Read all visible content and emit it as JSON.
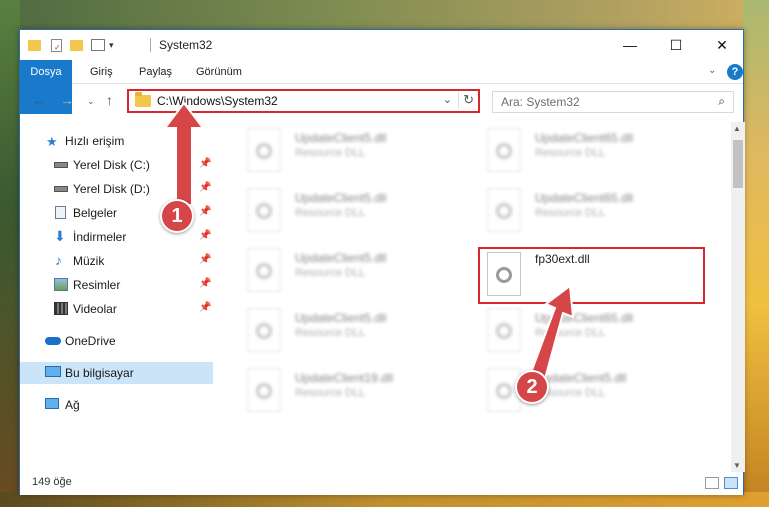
{
  "window": {
    "title": "System32",
    "min_glyph": "—",
    "max_glyph": "☐",
    "close_glyph": "✕"
  },
  "ribbon": {
    "tabs": [
      "Dosya",
      "Giriş",
      "Paylaş",
      "Görünüm"
    ]
  },
  "navigation": {
    "address_path": "C:\\Windows\\System32",
    "search_placeholder": "Ara: System32"
  },
  "sidebar": {
    "items": [
      {
        "label": "Hızlı erişim",
        "icon": "star-icon"
      },
      {
        "label": "Yerel Disk (C:)",
        "icon": "drive-icon",
        "pinned": true
      },
      {
        "label": "Yerel Disk (D:)",
        "icon": "drive-icon",
        "pinned": true
      },
      {
        "label": "Belgeler",
        "icon": "documents-icon",
        "pinned": true
      },
      {
        "label": "İndirmeler",
        "icon": "download-icon",
        "pinned": true
      },
      {
        "label": "Müzik",
        "icon": "music-icon",
        "pinned": true
      },
      {
        "label": "Resimler",
        "icon": "pictures-icon",
        "pinned": true
      },
      {
        "label": "Videolar",
        "icon": "videos-icon",
        "pinned": true
      },
      {
        "label": "OneDrive",
        "icon": "cloud-icon"
      },
      {
        "label": "Bu bilgisayar",
        "icon": "computer-icon",
        "selected": true
      },
      {
        "label": "Ağ",
        "icon": "network-icon"
      }
    ]
  },
  "files": [
    {
      "name": "UpdateClient5.dll",
      "type": "Resource DLL"
    },
    {
      "name": "UpdateClient65.dll",
      "type": "Resource DLL"
    },
    {
      "name": "UpdateClient5.dll",
      "type": "Resource DLL"
    },
    {
      "name": "UpdateClient65.dll",
      "type": "Resource DLL"
    },
    {
      "name": "UpdateClient5.dll",
      "type": "Resource DLL"
    },
    {
      "name": "fp30ext.dll",
      "type": ""
    },
    {
      "name": "UpdateClient5.dll",
      "type": "Resource DLL"
    },
    {
      "name": "UpdateClient65.dll",
      "type": "Resource DLL"
    },
    {
      "name": "UpdateClient19.dll",
      "type": "Resource DLL"
    },
    {
      "name": "UpdateClient5.dll",
      "type": "Resource DLL"
    }
  ],
  "status": {
    "item_count": "149 öğe"
  },
  "annotations": {
    "step1": "1",
    "step2": "2",
    "color": "#d6262e"
  }
}
